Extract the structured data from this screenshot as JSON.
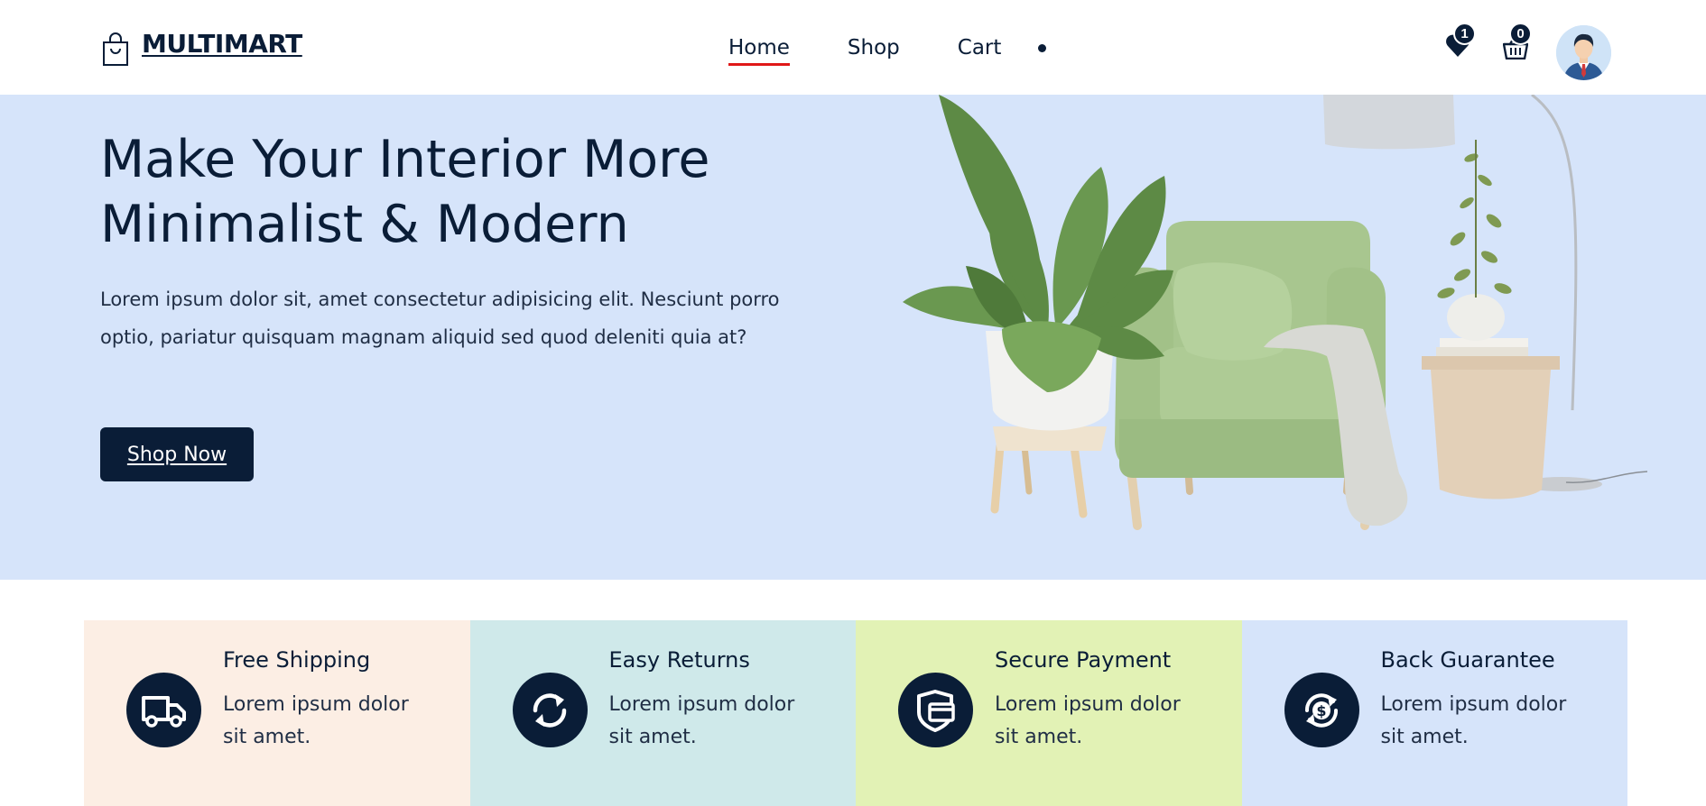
{
  "header": {
    "brand": "MULTIMART",
    "nav": [
      {
        "label": "Home",
        "active": true
      },
      {
        "label": "Shop",
        "active": false
      },
      {
        "label": "Cart",
        "active": false
      }
    ],
    "wishlist_count": "1",
    "cart_count": "0"
  },
  "hero": {
    "title": "Make Your Interior More Minimalist & Modern",
    "description": "Lorem ipsum dolor sit, amet consectetur adipisicing elit. Nesciunt porro optio, pariatur quisquam magnam aliquid sed quod deleniti quia at?",
    "cta": "Shop Now"
  },
  "services": [
    {
      "title": "Free Shipping",
      "text": "Lorem ipsum dolor sit amet.",
      "bg": "#fceee4",
      "icon": "truck-icon"
    },
    {
      "title": "Easy Returns",
      "text": "Lorem ipsum dolor sit amet.",
      "bg": "#cfe9ea",
      "icon": "refresh-icon"
    },
    {
      "title": "Secure Payment",
      "text": "Lorem ipsum dolor sit amet.",
      "bg": "#e2f2b5",
      "icon": "secure-card-icon"
    },
    {
      "title": "Back Guarantee",
      "text": "Lorem ipsum dolor sit amet.",
      "bg": "#d6e4fa",
      "icon": "money-back-icon"
    }
  ],
  "colors": {
    "primary": "#0a1d37",
    "hero_bg": "#d6e4fa",
    "active_underline": "#e01818"
  }
}
